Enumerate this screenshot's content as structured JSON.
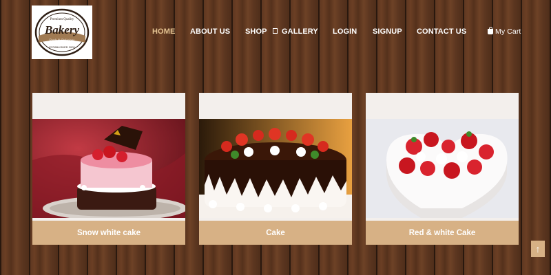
{
  "logo": {
    "top_text": "Premium Quality",
    "brand": "Bakery",
    "bottom_text": "Fresh & Delicious",
    "tag": "ESTABLISHED 2002"
  },
  "nav": {
    "items": [
      "HOME",
      "ABOUT US",
      "SHOP",
      "GALLERY",
      "LOGIN",
      "SIGNUP",
      "CONTACT US"
    ],
    "active": "HOME",
    "cart_label": "My Cart"
  },
  "products": [
    {
      "name": "Snow white cake"
    },
    {
      "name": "Cake"
    },
    {
      "name": "Red & white Cake"
    }
  ],
  "colors": {
    "accent": "#d7b185",
    "active_nav": "#e6c593",
    "wood": "#5a3520"
  },
  "icons": {
    "shop_dropdown": "chevron-down-icon",
    "cart": "shopping-bag-icon",
    "scroll_top": "arrow-up-icon"
  },
  "scroll_top_label": "↑"
}
